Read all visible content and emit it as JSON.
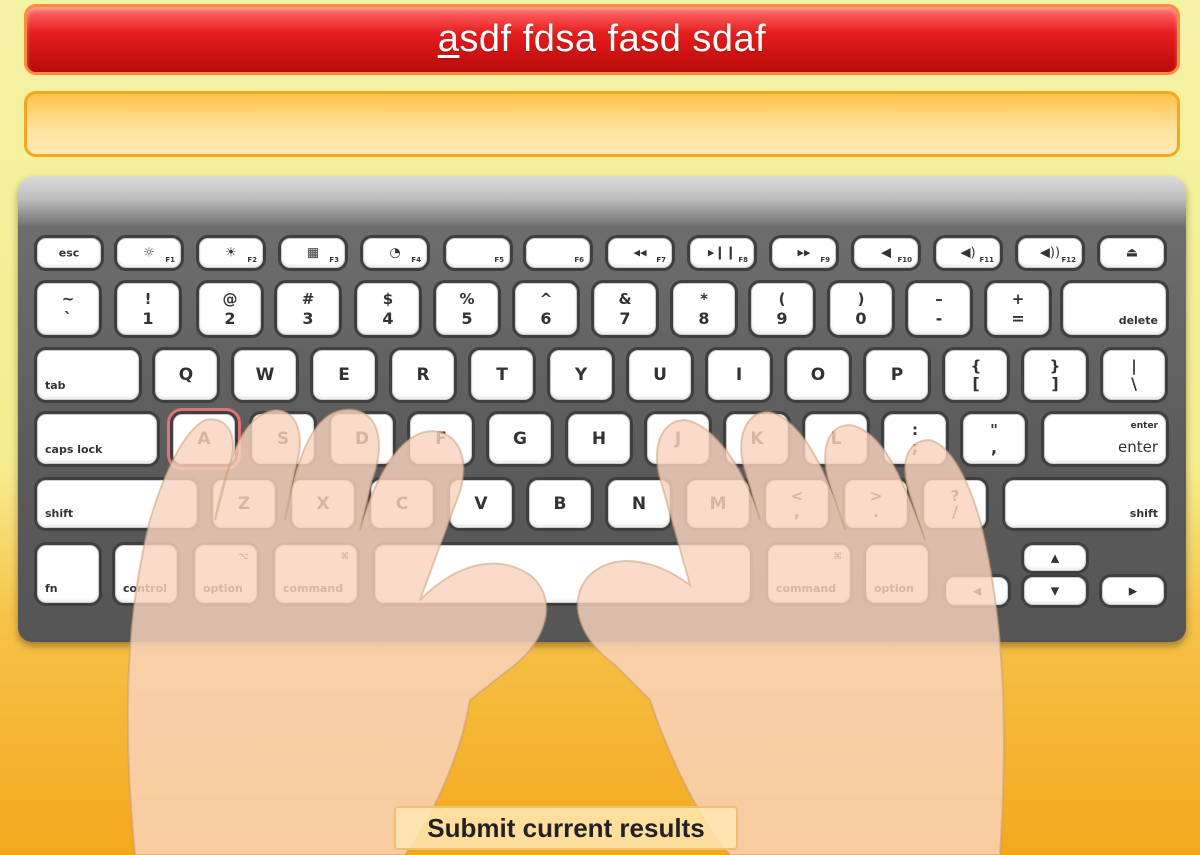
{
  "prompt": {
    "current_char": "a",
    "rest": "sdf fdsa fasd sdaf"
  },
  "typed_value": "",
  "highlighted_key": "A",
  "keyboard": {
    "fn_row": [
      {
        "label": "esc"
      },
      {
        "icon": "brightness-down-icon",
        "glyph": "☼",
        "fn": "F1"
      },
      {
        "icon": "brightness-up-icon",
        "glyph": "☀",
        "fn": "F2"
      },
      {
        "icon": "mission-control-icon",
        "glyph": "▦",
        "fn": "F3"
      },
      {
        "icon": "dashboard-icon",
        "glyph": "◔",
        "fn": "F4"
      },
      {
        "icon": "blank-icon",
        "glyph": "",
        "fn": "F5"
      },
      {
        "icon": "blank-icon",
        "glyph": "",
        "fn": "F6"
      },
      {
        "icon": "rewind-icon",
        "glyph": "◂◂",
        "fn": "F7"
      },
      {
        "icon": "play-pause-icon",
        "glyph": "▸❙❙",
        "fn": "F8"
      },
      {
        "icon": "fast-forward-icon",
        "glyph": "▸▸",
        "fn": "F9"
      },
      {
        "icon": "mute-icon",
        "glyph": "◀",
        "fn": "F10"
      },
      {
        "icon": "volume-down-icon",
        "glyph": "◀)",
        "fn": "F11"
      },
      {
        "icon": "volume-up-icon",
        "glyph": "◀))",
        "fn": "F12"
      },
      {
        "icon": "eject-icon",
        "glyph": "⏏",
        "fn": ""
      }
    ],
    "number_row": [
      {
        "top": "~",
        "bot": "`"
      },
      {
        "top": "!",
        "bot": "1"
      },
      {
        "top": "@",
        "bot": "2"
      },
      {
        "top": "#",
        "bot": "3"
      },
      {
        "top": "$",
        "bot": "4"
      },
      {
        "top": "%",
        "bot": "5"
      },
      {
        "top": "^",
        "bot": "6"
      },
      {
        "top": "&",
        "bot": "7"
      },
      {
        "top": "*",
        "bot": "8"
      },
      {
        "top": "(",
        "bot": "9"
      },
      {
        "top": ")",
        "bot": "0"
      },
      {
        "top": "–",
        "bot": "-"
      },
      {
        "top": "+",
        "bot": "="
      },
      {
        "label": "delete"
      }
    ],
    "qwerty_row": [
      {
        "label": "tab"
      },
      {
        "main": "Q"
      },
      {
        "main": "W"
      },
      {
        "main": "E"
      },
      {
        "main": "R"
      },
      {
        "main": "T"
      },
      {
        "main": "Y"
      },
      {
        "main": "U"
      },
      {
        "main": "I"
      },
      {
        "main": "O"
      },
      {
        "main": "P"
      },
      {
        "top": "{",
        "bot": "["
      },
      {
        "top": "}",
        "bot": "]"
      },
      {
        "top": "|",
        "bot": "\\"
      }
    ],
    "home_row": [
      {
        "label": "caps lock"
      },
      {
        "main": "A"
      },
      {
        "main": "S"
      },
      {
        "main": "D"
      },
      {
        "main": "F"
      },
      {
        "main": "G"
      },
      {
        "main": "H"
      },
      {
        "main": "J"
      },
      {
        "main": "K"
      },
      {
        "main": "L"
      },
      {
        "top": ":",
        "bot": ";"
      },
      {
        "top": "\"",
        "bot": ","
      },
      {
        "label": "enter",
        "sub": "enter"
      }
    ],
    "shift_row": [
      {
        "label": "shift"
      },
      {
        "main": "Z"
      },
      {
        "main": "X"
      },
      {
        "main": "C"
      },
      {
        "main": "V"
      },
      {
        "main": "B"
      },
      {
        "main": "N"
      },
      {
        "main": "M"
      },
      {
        "top": "<",
        "bot": ","
      },
      {
        "top": ">",
        "bot": "."
      },
      {
        "top": "?",
        "bot": "/"
      },
      {
        "label": "shift"
      }
    ],
    "bottom_row": [
      {
        "label": "fn"
      },
      {
        "label": "control"
      },
      {
        "label": "option",
        "glyph": "⌥"
      },
      {
        "label": "command",
        "glyph": "⌘"
      },
      {
        "label": ""
      },
      {
        "label": "command",
        "glyph": "⌘"
      },
      {
        "label": "option"
      },
      {
        "glyph": "◀"
      },
      {
        "glyph": "▲"
      },
      {
        "glyph": "▼"
      },
      {
        "glyph": "▶"
      }
    ]
  },
  "submit_label": "Submit current results",
  "colors": {
    "prompt_bar": "#e61d1d",
    "input_bar": "#ffc24a",
    "keyboard_frame": "#5b5b5b",
    "highlight": "#e2737a",
    "hand": "#f9d3bd"
  }
}
